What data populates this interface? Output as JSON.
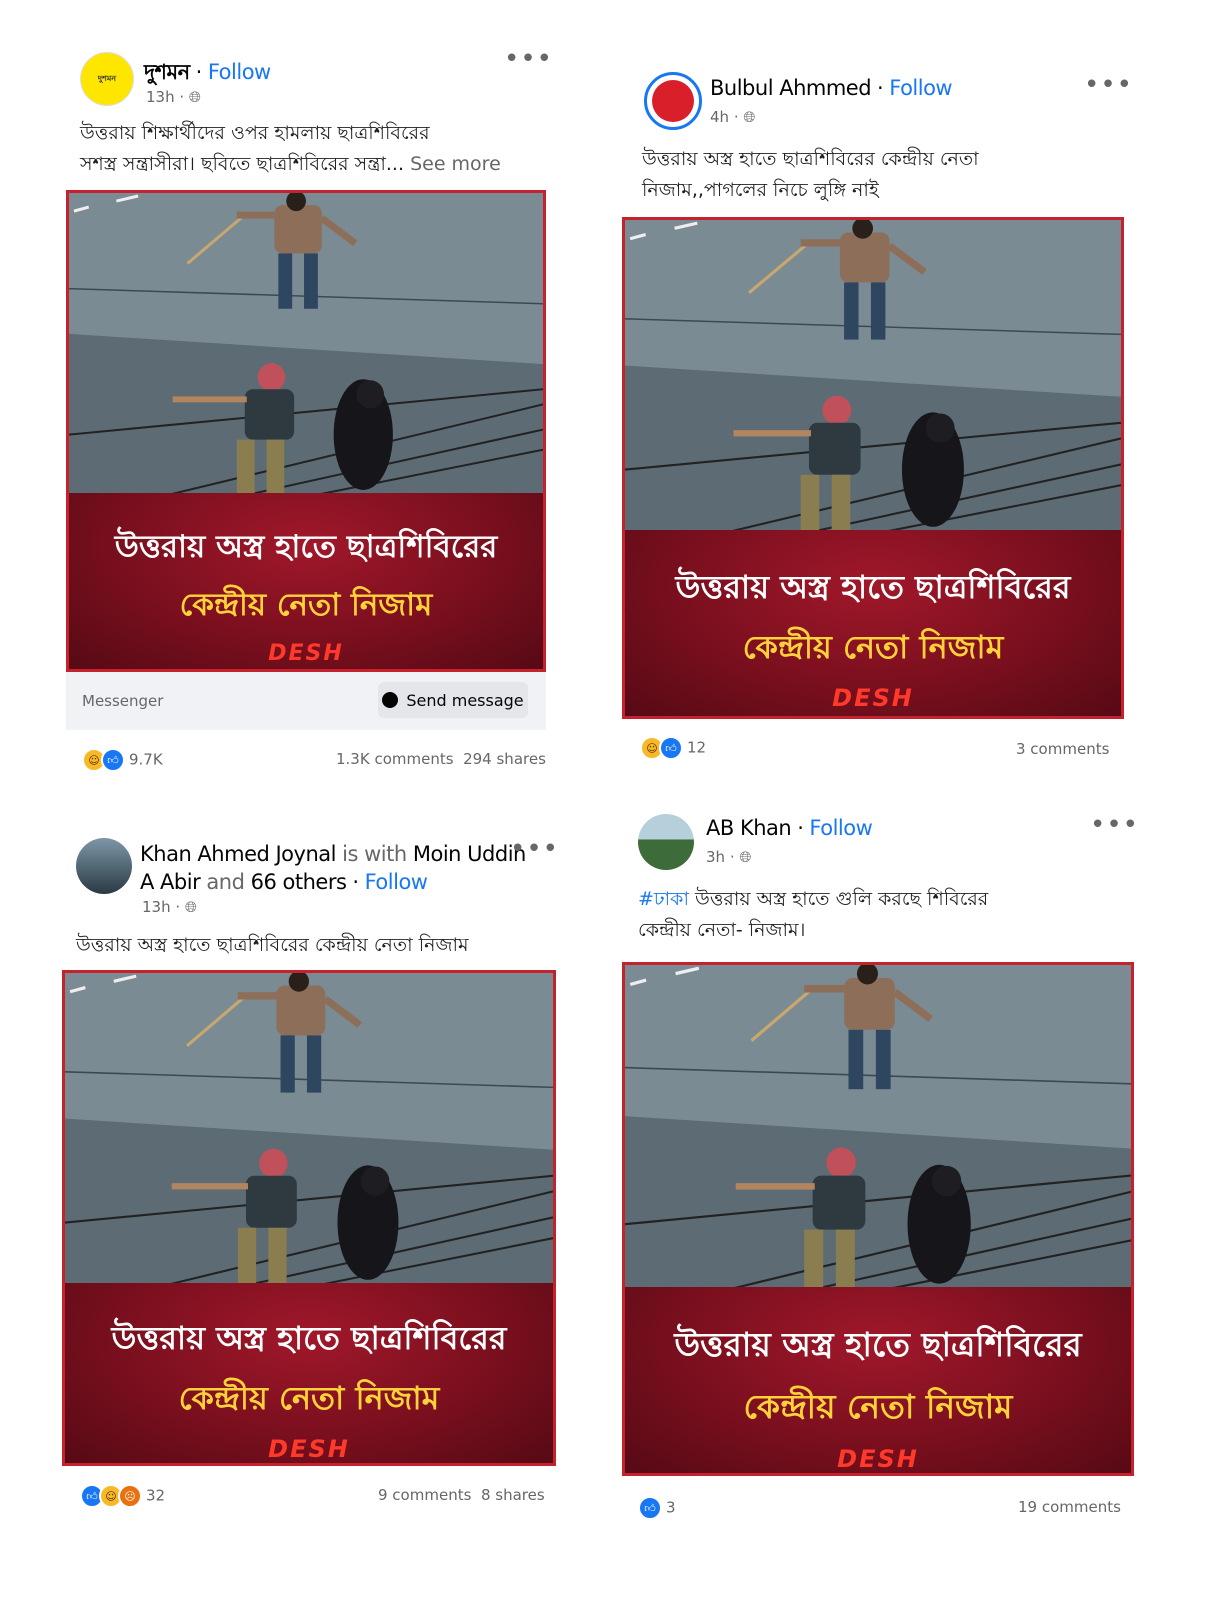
{
  "posts": [
    {
      "author": "দুশমন",
      "avatar_text": "দুশমন",
      "follow": "Follow",
      "time": "13h",
      "caption_lines": [
        "উত্তরায় শিক্ষার্থীদের ওপর হামলায় ছাত্রশিবিরের",
        "সশস্ত্র সন্ত্রাসীরা। ছবিতে ছাত্রশিবিরের সন্ত্রা..."
      ],
      "see_more": "See more",
      "banner": {
        "line1": "উত্তরায় অস্ত্র হাতে ছাত্রশিবিরের",
        "line2": "কেন্দ্রীয় নেতা নিজাম",
        "logo": "DESH"
      },
      "messenger": {
        "label": "Messenger",
        "button": "Send message"
      },
      "reactions": "9.7K",
      "comments": "1.3K comments",
      "shares": "294 shares"
    },
    {
      "author": "Bulbul Ahmmed",
      "follow": "Follow",
      "time": "4h",
      "caption_lines": [
        "উত্তরায় অস্ত্র হাতে ছাত্রশিবিরের কেন্দ্রীয় নেতা",
        "নিজাম,,পাগলের নিচে লুঙ্গি নাই"
      ],
      "banner": {
        "line1": "উত্তরায় অস্ত্র হাতে ছাত্রশিবিরের",
        "line2": "কেন্দ্রীয় নেতা নিজাম",
        "logo": "DESH"
      },
      "reactions": "12",
      "comments": "3 comments"
    },
    {
      "author": "Khan Ahmed Joynal",
      "is_with": "is with",
      "with_name": "Moin Uddin",
      "with_name2": "A Abir",
      "and": "and",
      "others": "66 others",
      "follow": "Follow",
      "time": "13h",
      "caption_lines": [
        "উত্তরায় অস্ত্র হাতে ছাত্রশিবিরের কেন্দ্রীয় নেতা নিজাম"
      ],
      "banner": {
        "line1": "উত্তরায় অস্ত্র হাতে ছাত্রশিবিরের",
        "line2": "কেন্দ্রীয় নেতা নিজাম",
        "logo": "DESH"
      },
      "reactions": "32",
      "comments": "9 comments",
      "shares": "8 shares"
    },
    {
      "author": "AB Khan",
      "follow": "Follow",
      "time": "3h",
      "hashtag": "#ঢাকা",
      "caption_lines": [
        "উত্তরায় অস্ত্র হাতে গুলি করছে শিবিরের",
        "কেন্দ্রীয় নেতা- নিজাম।"
      ],
      "banner": {
        "line1": "উত্তরায় অস্ত্র হাতে ছাত্রশিবিরের",
        "line2": "কেন্দ্রীয় নেতা নিজাম",
        "logo": "DESH"
      },
      "reactions": "3",
      "comments": "19 comments"
    }
  ],
  "colors": {
    "brand_blue": "#1877f2",
    "frame_red": "#c5222e",
    "banner_red": "#7a0f1e",
    "banner_yellow": "#ffd23a"
  }
}
